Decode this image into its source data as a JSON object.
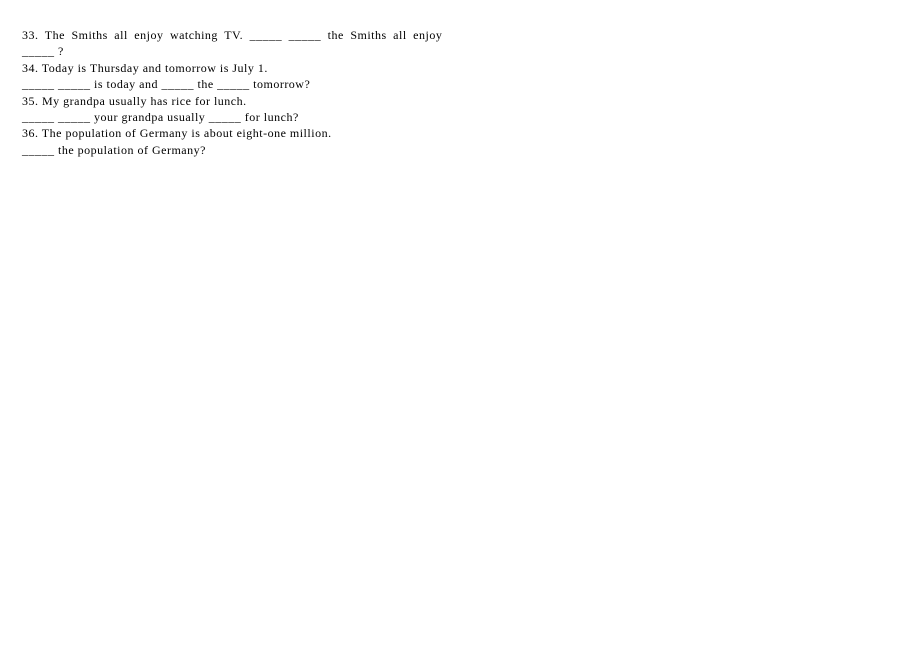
{
  "questions": {
    "q33": {
      "line1": "33.  The  Smiths  all  enjoy  watching  TV.    _____  _____  the  Smiths  all  enjoy",
      "line2": "_____ ?"
    },
    "q34": {
      "line1": "34. Today is Thursday and tomorrow is July 1.",
      "line2": "_____ _____ is today and _____ the _____ tomorrow?"
    },
    "q35": {
      "line1": "35. My grandpa usually has rice for lunch.",
      "line2": " _____ _____ your grandpa usually _____ for lunch?"
    },
    "q36": {
      "line1": "36. The population of Germany is about eight-one million.",
      "line2": "  _____ the population of Germany?"
    }
  }
}
